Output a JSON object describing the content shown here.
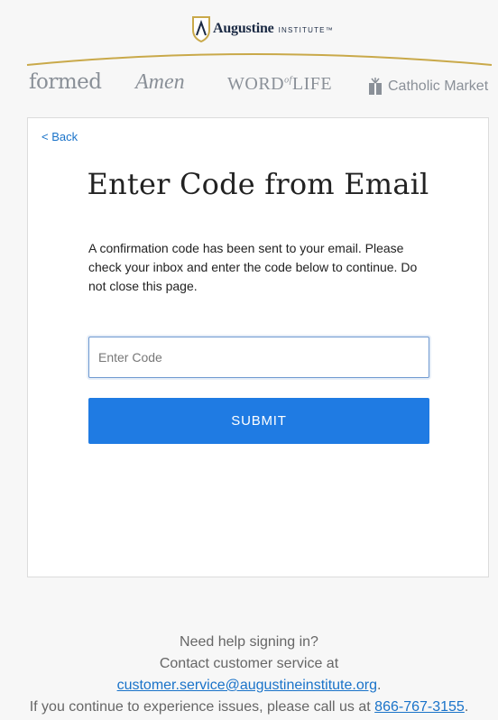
{
  "header": {
    "logo_main": "Augustine",
    "logo_sub": "INSTITUTE™",
    "brands": {
      "formed": "formed",
      "amen": "Amen",
      "word_of_life_a": "WORD",
      "word_of_life_of": "of",
      "word_of_life_b": "LIFE",
      "catholic_market": "Catholic Market"
    }
  },
  "card": {
    "back_label": "< Back",
    "title": "Enter Code from Email",
    "description": "A confirmation code has been sent to your email. Please check your inbox and enter the code below to continue. Do not close this page.",
    "code_placeholder": "Enter Code",
    "code_value": "",
    "submit_label": "SUBMIT"
  },
  "footer": {
    "line1": "Need help signing in?",
    "line2": "Contact customer service at",
    "email": "customer.service@augustineinstitute.org",
    "email_suffix": ".",
    "line4_prefix": "If you continue to experience issues, please call us at ",
    "phone": "866-767-3155",
    "phone_suffix": "."
  },
  "colors": {
    "accent": "#1f7be3",
    "link": "#1a73c9",
    "gold_arc": "#c9a94a",
    "brand_gray": "#8a9098"
  }
}
